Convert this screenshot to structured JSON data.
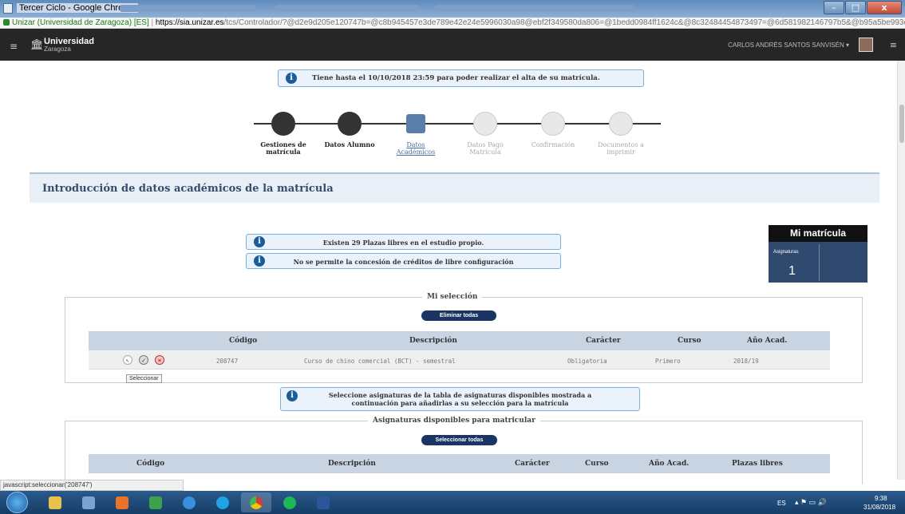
{
  "window": {
    "title": "Tercer Ciclo - Google Chrome",
    "buttons": {
      "minimize": "–",
      "maximize": "□",
      "close": "x"
    }
  },
  "urlbar": {
    "site": "Unizar (Universidad de Zaragoza) [ES]",
    "host": "https://sia.unizar.es",
    "path": "/tcs/Controlador/?@d2e9d205e120747b=@c8b945457e3de789e42e24e5996030a98@ebf2f349580da806=@1bedd0984ff1624c&@8c32484454873497=@6d581982146797b5&@b95a5be993e..."
  },
  "header": {
    "menu_icon": "≡",
    "logo_title": "Universidad",
    "logo_sub": "Zaragoza",
    "user": "CARLOS ANDRÉS SANTOS SANVISÉN ▾",
    "logout_icon": "≡"
  },
  "deadline_notice": "Tiene hasta el 10/10/2018 23:59 para poder realizar el alta de su matrícula.",
  "steps": [
    {
      "line1": "Gestiones de",
      "line2": "matrícula",
      "state": "done"
    },
    {
      "line1": "Datos Alumno",
      "line2": "",
      "state": "done"
    },
    {
      "line1": "Datos",
      "line2": "Académicos",
      "state": "current"
    },
    {
      "line1": "Datos Pago",
      "line2": "Matrícula",
      "state": "pending"
    },
    {
      "line1": "Confirmación",
      "line2": "",
      "state": "pending"
    },
    {
      "line1": "Documentos a",
      "line2": "imprimir",
      "state": "pending"
    }
  ],
  "section_title": "Introducción de datos académicos de la matrícula",
  "notices": {
    "plazas": "Existen  29  Plazas libres en el estudio propio.",
    "creditos": "No se permite la concesión de créditos de libre configuración",
    "seleccione_1": "Seleccione asignaturas de la tabla de asignaturas disponibles mostrada a",
    "seleccione_2": "continuación para añadirlas a su selección para la matrícula"
  },
  "mi_matricula": {
    "title": "Mi matrícula",
    "label": "Asignaturas",
    "count": "1"
  },
  "seleccion": {
    "legend": "Mi selección",
    "button": "Eliminar todas",
    "columns": [
      "Código",
      "Descripción",
      "Carácter",
      "Curso",
      "Año Acad."
    ],
    "rows": [
      {
        "codigo": "208747",
        "descripcion": "Curso de chino comercial (BCT) - semestral",
        "caracter": "Obligatoria",
        "curso": "Primero",
        "anio": "2018/19"
      }
    ],
    "tooltip": "Seleccionar"
  },
  "disponibles": {
    "legend": "Asignaturas disponibles para matricular",
    "button": "Seleccionar todas",
    "columns": [
      "Código",
      "Descripción",
      "Carácter",
      "Curso",
      "Año Acad.",
      "Plazas libres"
    ]
  },
  "status_bar": "javascript:seleccionar('208747')",
  "tray": {
    "lang": "ES",
    "time": "9:38",
    "date": "31/08/2018"
  },
  "colors": {
    "accent": "#1a3563",
    "header_bg": "#262626",
    "table_header": "#c9d4e2"
  }
}
